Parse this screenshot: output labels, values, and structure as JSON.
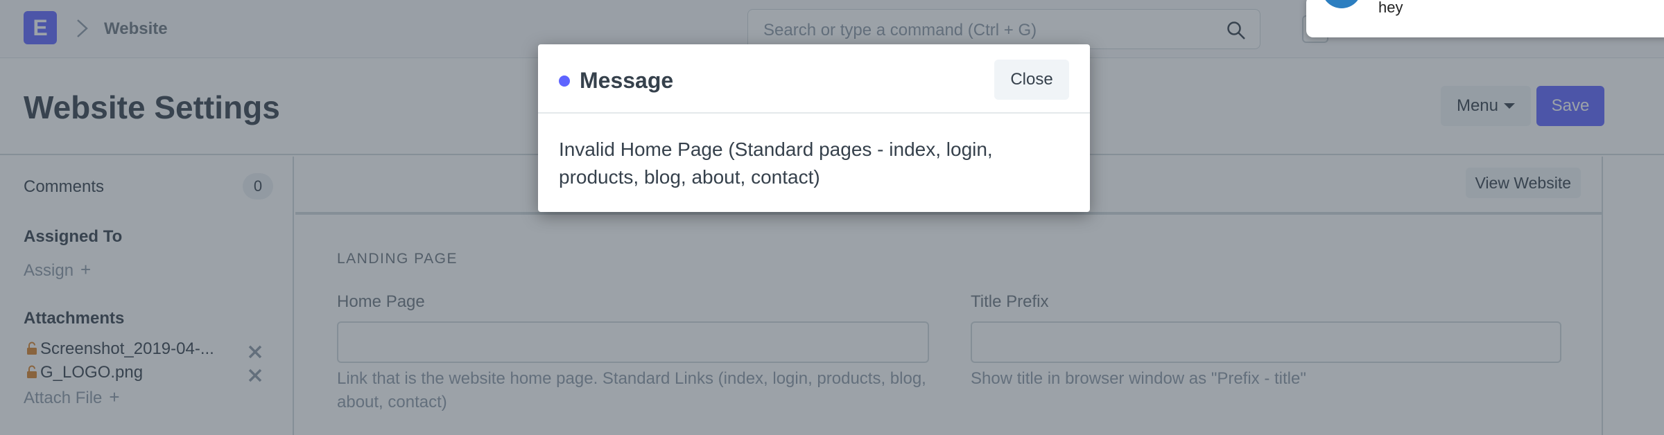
{
  "navbar": {
    "logo_letter": "E",
    "breadcrumb": "Website",
    "search_placeholder": "Search or type a command (Ctrl + G)"
  },
  "notification": {
    "text": "hey"
  },
  "page": {
    "title": "Website Settings",
    "menu_label": "Menu",
    "save_label": "Save"
  },
  "sidebar": {
    "comments_label": "Comments",
    "comments_count": "0",
    "assigned_heading": "Assigned To",
    "assign_label": "Assign",
    "attachments_heading": "Attachments",
    "attachments": [
      {
        "name": "Screenshot_2019-04-..."
      },
      {
        "name": "G_LOGO.png"
      }
    ],
    "attach_file_label": "Attach File"
  },
  "main": {
    "view_website_label": "View Website",
    "section_label": "LANDING PAGE",
    "fields": [
      {
        "label": "Home Page",
        "value": "",
        "help": "Link that is the website home page. Standard Links (index, login, products, blog, about, contact)"
      },
      {
        "label": "Title Prefix",
        "value": "",
        "help": "Show title in browser window as \"Prefix - title\""
      }
    ]
  },
  "dialog": {
    "title": "Message",
    "close_label": "Close",
    "message": "Invalid Home Page (Standard pages - index, login, products, blog, about, contact)"
  },
  "colors": {
    "primary": "#5e64ff",
    "overlay": "rgba(58,70,82,0.5)"
  }
}
